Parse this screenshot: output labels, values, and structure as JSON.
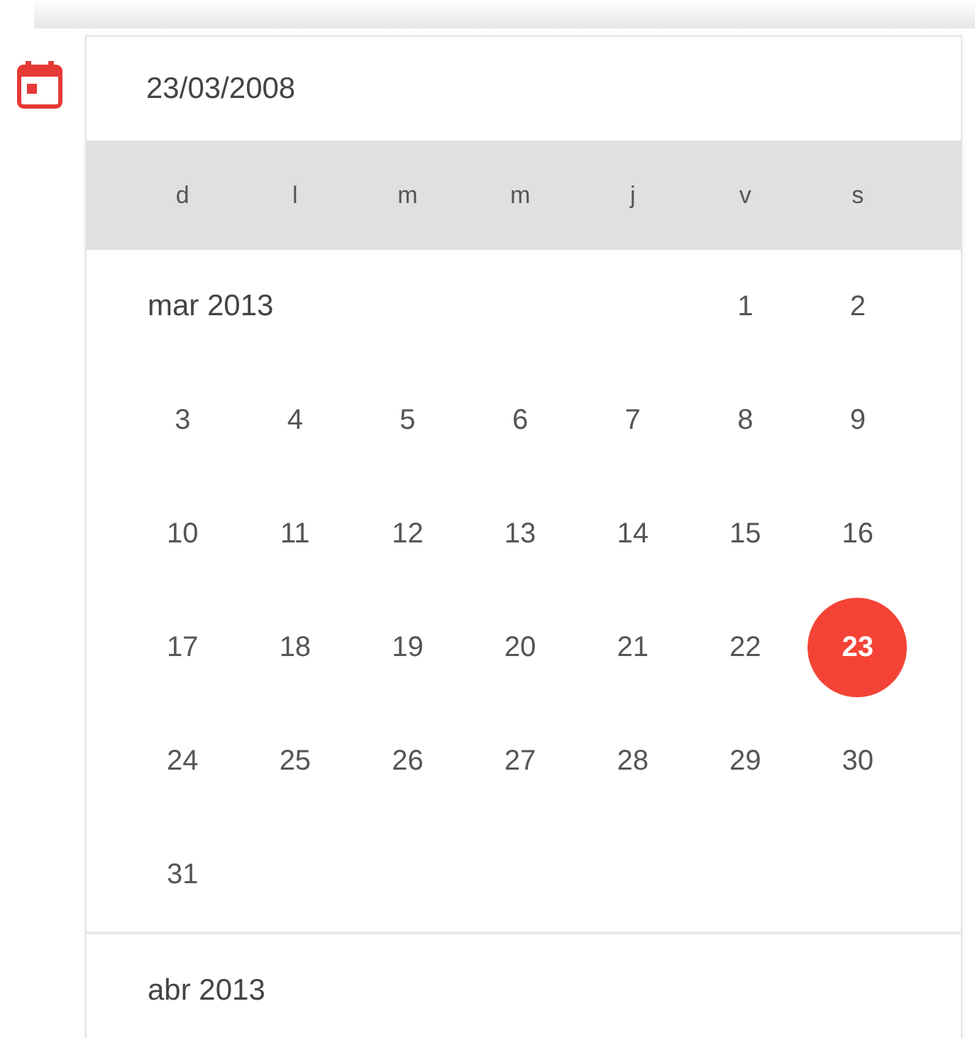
{
  "date_field": {
    "value": "23/03/2008"
  },
  "weekdays": [
    "d",
    "l",
    "m",
    "m",
    "j",
    "v",
    "s"
  ],
  "months": [
    {
      "label": "mar 2013",
      "weeks": [
        [
          {
            "day": "1",
            "selected": false
          },
          {
            "day": "2",
            "selected": false
          }
        ],
        [
          {
            "day": "3",
            "selected": false
          },
          {
            "day": "4",
            "selected": false
          },
          {
            "day": "5",
            "selected": false
          },
          {
            "day": "6",
            "selected": false
          },
          {
            "day": "7",
            "selected": false
          },
          {
            "day": "8",
            "selected": false
          },
          {
            "day": "9",
            "selected": false
          }
        ],
        [
          {
            "day": "10",
            "selected": false
          },
          {
            "day": "11",
            "selected": false
          },
          {
            "day": "12",
            "selected": false
          },
          {
            "day": "13",
            "selected": false
          },
          {
            "day": "14",
            "selected": false
          },
          {
            "day": "15",
            "selected": false
          },
          {
            "day": "16",
            "selected": false
          }
        ],
        [
          {
            "day": "17",
            "selected": false
          },
          {
            "day": "18",
            "selected": false
          },
          {
            "day": "19",
            "selected": false
          },
          {
            "day": "20",
            "selected": false
          },
          {
            "day": "21",
            "selected": false
          },
          {
            "day": "22",
            "selected": false
          },
          {
            "day": "23",
            "selected": true
          }
        ],
        [
          {
            "day": "24",
            "selected": false
          },
          {
            "day": "25",
            "selected": false
          },
          {
            "day": "26",
            "selected": false
          },
          {
            "day": "27",
            "selected": false
          },
          {
            "day": "28",
            "selected": false
          },
          {
            "day": "29",
            "selected": false
          },
          {
            "day": "30",
            "selected": false
          }
        ],
        [
          {
            "day": "31",
            "selected": false
          }
        ]
      ]
    },
    {
      "label": "abr 2013"
    }
  ]
}
